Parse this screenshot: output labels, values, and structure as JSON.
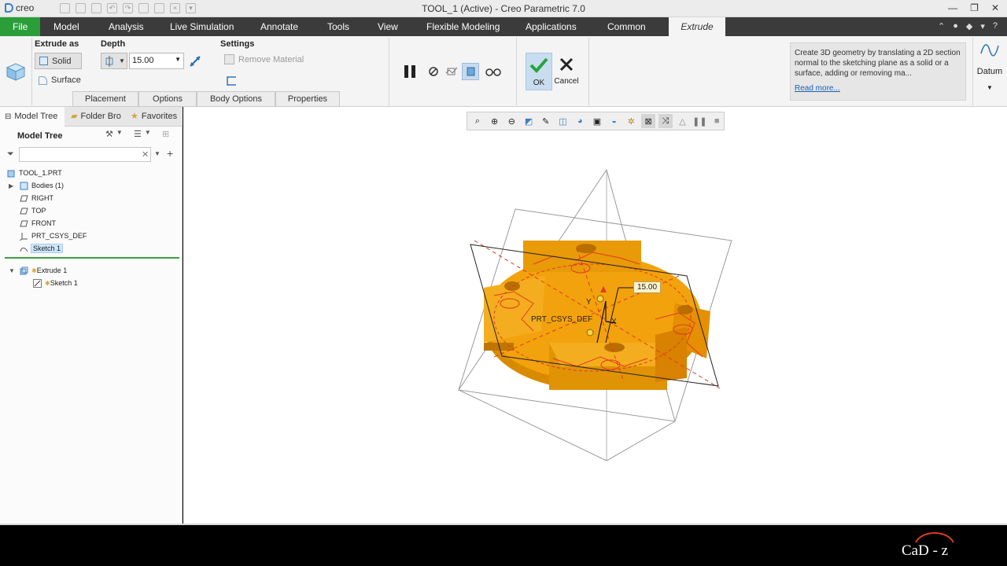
{
  "window": {
    "app_logo": "creo",
    "title": "TOOL_1 (Active) - Creo Parametric 7.0"
  },
  "menu": {
    "tabs": [
      "File",
      "Model",
      "Analysis",
      "Live Simulation",
      "Annotate",
      "Tools",
      "View",
      "Flexible Modeling",
      "Applications",
      "Common",
      "Extrude"
    ],
    "active": "Extrude"
  },
  "ribbon": {
    "extrude_as_label": "Extrude as",
    "solid_label": "Solid",
    "surface_label": "Surface",
    "depth_label": "Depth",
    "depth_value": "15.00",
    "settings_label": "Settings",
    "remove_material_label": "Remove Material",
    "ok_label": "OK",
    "cancel_label": "Cancel",
    "datum_label": "Datum",
    "subtabs": [
      "Placement",
      "Options",
      "Body Options",
      "Properties"
    ],
    "tooltip_text": "Create 3D geometry by translating a 2D section normal to the sketching plane as a solid or a surface, adding or removing ma...",
    "tooltip_link": "Read more..."
  },
  "left_pane": {
    "tabs": [
      "Model Tree",
      "Folder Bro",
      "Favorites"
    ],
    "header": "Model Tree",
    "filter_value": "",
    "tree": [
      {
        "label": "TOOL_1.PRT",
        "icon": "part-icon"
      },
      {
        "label": "Bodies (1)",
        "icon": "bodies-icon"
      },
      {
        "label": "RIGHT",
        "icon": "datum-plane-icon"
      },
      {
        "label": "TOP",
        "icon": "datum-plane-icon"
      },
      {
        "label": "FRONT",
        "icon": "datum-plane-icon"
      },
      {
        "label": "PRT_CSYS_DEF",
        "icon": "csys-icon"
      },
      {
        "label": "Sketch 1",
        "icon": "sketch-icon"
      },
      {
        "label": "Extrude 1",
        "icon": "extrude-icon"
      },
      {
        "label": "Sketch 1",
        "icon": "sketch-icon"
      }
    ]
  },
  "graphics": {
    "dimension_value": "15.00",
    "csys_label": "PRT_CSYS_DEF",
    "axis_x": "X",
    "axis_y": "Y",
    "model_color": "#f2a20c"
  },
  "brand": "CaD - z"
}
